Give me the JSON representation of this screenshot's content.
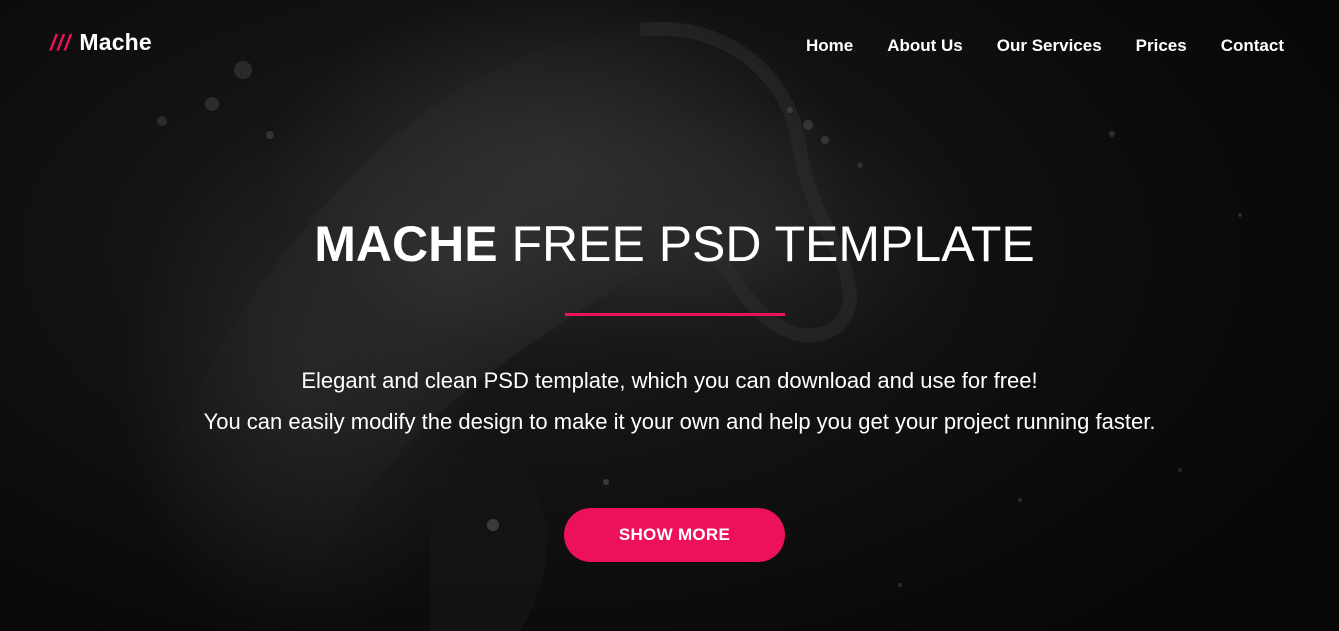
{
  "header": {
    "logo_slashes": "///",
    "logo_text": "Mache",
    "nav": [
      {
        "label": "Home"
      },
      {
        "label": "About Us"
      },
      {
        "label": "Our Services"
      },
      {
        "label": "Prices"
      },
      {
        "label": "Contact"
      }
    ]
  },
  "hero": {
    "title_bold": "MACHE",
    "title_rest": " FREE PSD TEMPLATE",
    "description_line1": "Elegant and clean PSD template, which you can download and use for free!",
    "description_line2": "You can easily modify the design to make it your own and help you get your project running faster.",
    "cta_label": "SHOW MORE"
  },
  "colors": {
    "accent": "#ed1159",
    "background": "#0d0d0d",
    "text": "#ffffff"
  }
}
